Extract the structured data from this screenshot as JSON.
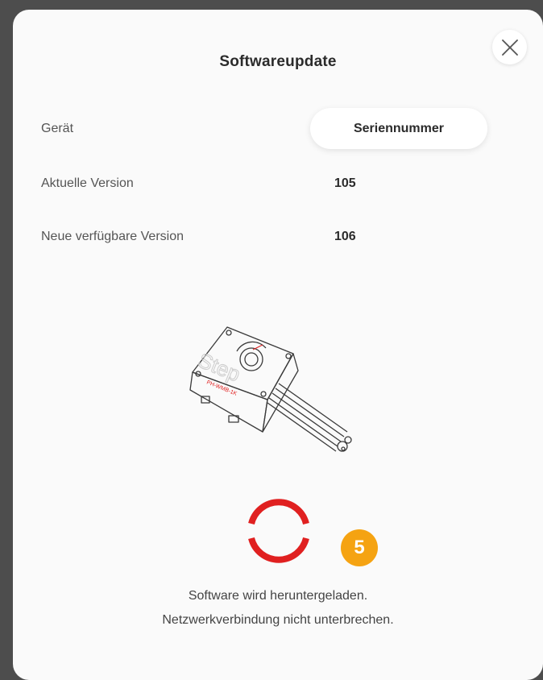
{
  "dialog": {
    "title": "Softwareupdate",
    "close_icon": "close-icon"
  },
  "info": {
    "device_label": "Gerät",
    "serial_button_label": "Seriennummer",
    "current_version_label": "Aktuelle Version",
    "current_version_value": "105",
    "new_version_label": "Neue verfügbare Version",
    "new_version_value": "106"
  },
  "device_image": {
    "icon": "heater-device-image"
  },
  "progress": {
    "icon": "loading-spinner-icon",
    "color": "#e02020"
  },
  "step_badge": {
    "number": "5",
    "color": "#f5a312"
  },
  "status": {
    "line1": "Software wird heruntergeladen.",
    "line2": "Netzwerkverbindung nicht unterbrechen."
  }
}
